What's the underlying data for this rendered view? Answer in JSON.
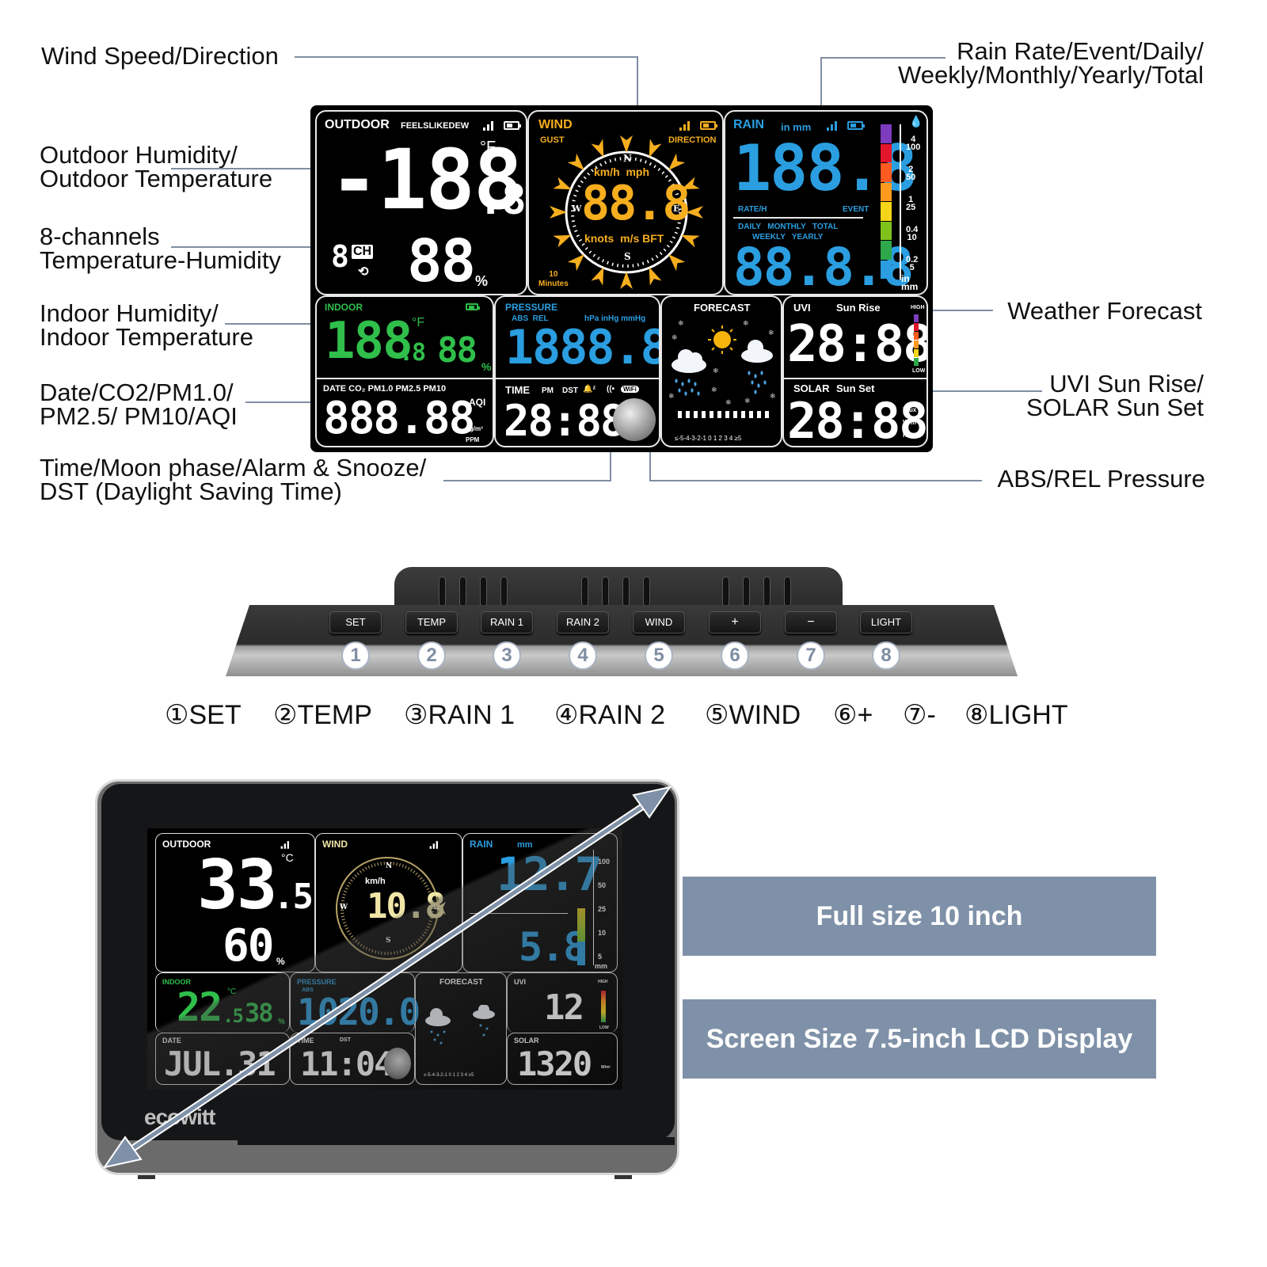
{
  "callouts": {
    "wind": "Wind Speed/Direction",
    "outdoor": "Outdoor Humidity/\nOutdoor Temperature",
    "channels": "8-channels\nTemperature-Humidity",
    "indoor": "Indoor Humidity/\nIndoor Temperature",
    "date": "Date/CO2/PM1.0/\nPM2.5/ PM10/AQI",
    "time": "Time/Moon phase/Alarm & Snooze/\nDST (Daylight Saving Time)",
    "rain": "Rain Rate/Event/Daily/\nWeekly/Monthly/Yearly/Total",
    "forecast": "Weather Forecast",
    "uvi": "UVI Sun Rise/\nSOLAR Sun Set",
    "pressure": "ABS/REL Pressure"
  },
  "lcd": {
    "outdoor": {
      "title": "OUTDOOR",
      "flags": "FEELSLIKEDEW",
      "temp": "-188",
      "temp_dec": ".8",
      "unit": "°F",
      "hum": "88",
      "hum_unit": "%",
      "ch_digit": "8",
      "ch_label": "CH"
    },
    "wind": {
      "title": "WIND",
      "gust": "GUST",
      "direction": "DIRECTION",
      "speed": "88.8",
      "units_top": "km/h  mph",
      "units_bottom": "knots  m/s BFT",
      "avg": "10\nMinutes",
      "n": "N",
      "s": "S",
      "e": "E",
      "w": "W"
    },
    "rain": {
      "title": "RAIN",
      "units": "in mm",
      "value_top": "188.8",
      "rate": "RATE/H",
      "event": "EVENT",
      "periods_row1": "DAILY   MONTHLY   TOTAL",
      "periods_row2": "WEEKLY   YEARLY",
      "value_bottom": "88.8.8",
      "scale": [
        "4\n100",
        "2\n50",
        "1\n25",
        "0.4\n10",
        "0.2\n5"
      ],
      "scale_unit": "in\nmm",
      "bar_colors": [
        "#7d3bbd",
        "#e3162b",
        "#ff5a1f",
        "#ff9a1f",
        "#f4d51a",
        "#7ec21b",
        "#2ea84a",
        "#2a9ee0"
      ]
    },
    "indoor": {
      "title": "INDOOR",
      "temp": "188",
      "temp_dec": ".8",
      "unit": "°F",
      "hum": "88",
      "hum_unit": "%"
    },
    "pressure": {
      "title": "PRESSURE",
      "modes": "ABS  REL",
      "units": "hPa inHg mmHg",
      "value": "1888.8"
    },
    "forecast": {
      "title": "FORECAST",
      "trend": "≤-5-4-3-2-1 0 1 2 3 4 ≥5"
    },
    "uvi": {
      "title": "UVI",
      "sunrise": "Sun Rise",
      "value": "28:88",
      "high": "HIGH",
      "low": "LOW"
    },
    "solar": {
      "title": "SOLAR",
      "sunset": "Sun Set",
      "value": "28:88",
      "units": [
        "Klux",
        "W/m²",
        "Kfc"
      ]
    },
    "date": {
      "labels": "DATE CO₂ PM1.0 PM2.5 PM10",
      "value": "888.88",
      "aqi": "AQI",
      "units": "ug/m³\nPPM"
    },
    "time": {
      "title": "TIME",
      "pm": "PM",
      "dst": "DST",
      "wifi": "WiFi",
      "value": "28:88"
    }
  },
  "console": {
    "buttons": [
      "SET",
      "TEMP",
      "RAIN 1",
      "RAIN 2",
      "WIND",
      "+",
      "−",
      "LIGHT"
    ],
    "numbers": [
      "1",
      "2",
      "3",
      "4",
      "5",
      "6",
      "7",
      "8"
    ],
    "legend": [
      "①SET",
      "②TEMP",
      "③RAIN 1",
      "④RAIN 2",
      "⑤WIND",
      "⑥+",
      "⑦-",
      "⑧LIGHT"
    ]
  },
  "device": {
    "brand": "ecowitt",
    "outdoor": {
      "title": "OUTDOOR",
      "temp": "33",
      "temp_dec": ".5",
      "unit": "°C",
      "hum": "60",
      "hum_unit": "%"
    },
    "wind": {
      "title": "WIND",
      "unit": "km/h",
      "speed": "10.8",
      "n": "N",
      "s": "S",
      "e": "E",
      "w": "W"
    },
    "rain": {
      "title": "RAIN",
      "unit": "mm",
      "rate": "12.7",
      "daily": "5.8",
      "scale": [
        "100",
        "50",
        "25",
        "10",
        "5"
      ],
      "scale_unit": "mm"
    },
    "indoor": {
      "title": "INDOOR",
      "temp": "22",
      "temp_dec": ".5",
      "unit": "°C",
      "hum": "38",
      "hum_unit": "%"
    },
    "pressure": {
      "title": "PRESSURE",
      "mode": "ABS",
      "value": "1020.0"
    },
    "forecast": {
      "title": "FORECAST",
      "trend": "≤-5-4-3-2-1 0 1 2 3 4 ≥5"
    },
    "uvi": {
      "title": "UVI",
      "value": "12",
      "high": "HIGH",
      "low": "LOW"
    },
    "date": {
      "title": "DATE",
      "value": "JUL.31"
    },
    "time": {
      "title": "TIME",
      "dst": "DST",
      "value": "11:04"
    },
    "solar": {
      "title": "SOLAR",
      "value": "1320",
      "unit": "W/m²"
    }
  },
  "info": {
    "full_size": "Full size 10 inch",
    "screen_size": "Screen Size 7.5-inch LCD Display"
  }
}
